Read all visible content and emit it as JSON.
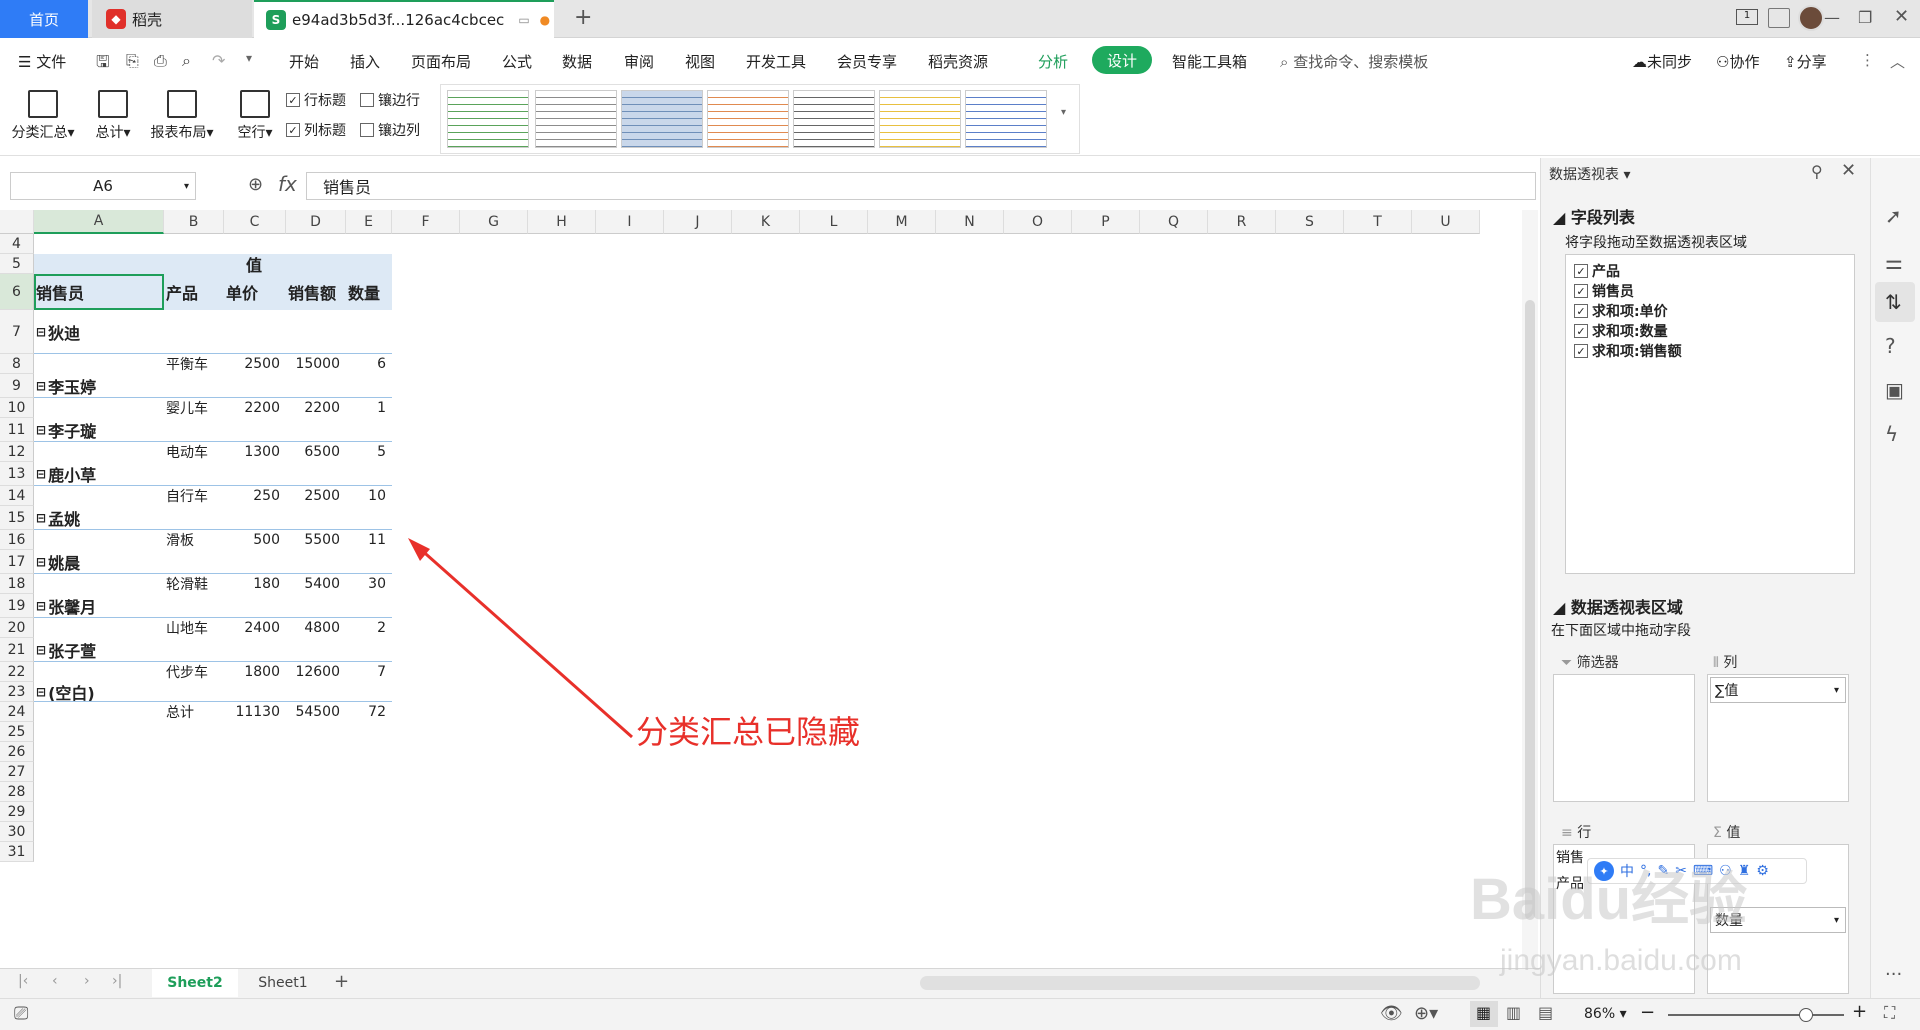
{
  "tabs": {
    "home": "首页",
    "daoke": "稻壳",
    "doc": "e94ad3b5d3f...126ac4cbcec"
  },
  "menu": {
    "file": "文件",
    "items": [
      "开始",
      "插入",
      "页面布局",
      "公式",
      "数据",
      "审阅",
      "视图",
      "开发工具",
      "会员专享",
      "稻壳资源",
      "分析",
      "设计",
      "智能工具箱"
    ],
    "search_placeholder": "查找命令、搜索模板",
    "sync": "未同步",
    "collab": "协作",
    "share": "分享"
  },
  "ribbon": {
    "buttons": [
      "分类汇总",
      "总计",
      "报表布局",
      "空行"
    ],
    "checkboxes": [
      {
        "label": "行标题",
        "checked": true
      },
      {
        "label": "镶边行",
        "checked": false
      },
      {
        "label": "列标题",
        "checked": true
      },
      {
        "label": "镶边列",
        "checked": false
      }
    ],
    "style_colors": [
      "#5aa35a",
      "#8c8c8c",
      "#6f8fb8",
      "#e08a50",
      "#666666",
      "#e8c040",
      "#5b7fc9"
    ]
  },
  "formula": {
    "namebox": "A6",
    "fx_value": "销售员"
  },
  "columns": [
    "A",
    "B",
    "C",
    "D",
    "E",
    "F",
    "G",
    "H",
    "I",
    "J",
    "K",
    "L",
    "M",
    "N",
    "O",
    "P",
    "Q",
    "R",
    "S",
    "T",
    "U"
  ],
  "rows": [
    "4",
    "5",
    "6",
    "7",
    "8",
    "9",
    "10",
    "11",
    "12",
    "13",
    "14",
    "15",
    "16",
    "17",
    "18",
    "19",
    "20",
    "21",
    "22",
    "23",
    "24",
    "25",
    "26",
    "27",
    "28",
    "29",
    "30",
    "31"
  ],
  "pivot": {
    "value_header": "值",
    "headers": [
      "销售员",
      "产品",
      "单价",
      "销售额",
      "数量"
    ],
    "groups": [
      {
        "seller": "狄迪",
        "product": "平衡车",
        "price": "2500",
        "sales": "15000",
        "qty": "6"
      },
      {
        "seller": "李玉婷",
        "product": "婴儿车",
        "price": "2200",
        "sales": "2200",
        "qty": "1"
      },
      {
        "seller": "李子璇",
        "product": "电动车",
        "price": "1300",
        "sales": "6500",
        "qty": "5"
      },
      {
        "seller": "鹿小草",
        "product": "自行车",
        "price": "250",
        "sales": "2500",
        "qty": "10"
      },
      {
        "seller": "孟姚",
        "product": "滑板",
        "price": "500",
        "sales": "5500",
        "qty": "11"
      },
      {
        "seller": "姚晨",
        "product": "轮滑鞋",
        "price": "180",
        "sales": "5400",
        "qty": "30"
      },
      {
        "seller": "张馨月",
        "product": "山地车",
        "price": "2400",
        "sales": "4800",
        "qty": "2"
      },
      {
        "seller": "张子萱",
        "product": "代步车",
        "price": "1800",
        "sales": "12600",
        "qty": "7"
      }
    ],
    "blank_label": "(空白)",
    "total": {
      "label": "总计",
      "price": "11130",
      "sales": "54500",
      "qty": "72"
    }
  },
  "annotation": {
    "text": "分类汇总已隐藏",
    "color": "#e8302a"
  },
  "sheets": [
    "Sheet2",
    "Sheet1"
  ],
  "panel": {
    "title": "数据透视表",
    "field_list_title": "字段列表",
    "field_hint": "将字段拖动至数据透视表区域",
    "fields": [
      "产品",
      "销售员",
      "求和项:单价",
      "求和项:数量",
      "求和项:销售额"
    ],
    "area_title": "数据透视表区域",
    "area_hint": "在下面区域中拖动字段",
    "filter_label": "筛选器",
    "column_label": "列",
    "column_value": "∑值",
    "row_label": "行",
    "value_label": "值",
    "row_items": [
      "销售",
      "产品"
    ],
    "value_items": [
      "数量"
    ]
  },
  "status": {
    "zoom": "86%"
  },
  "watermark": {
    "brand": "Baidu经验",
    "url": "jingyan.baidu.com"
  }
}
